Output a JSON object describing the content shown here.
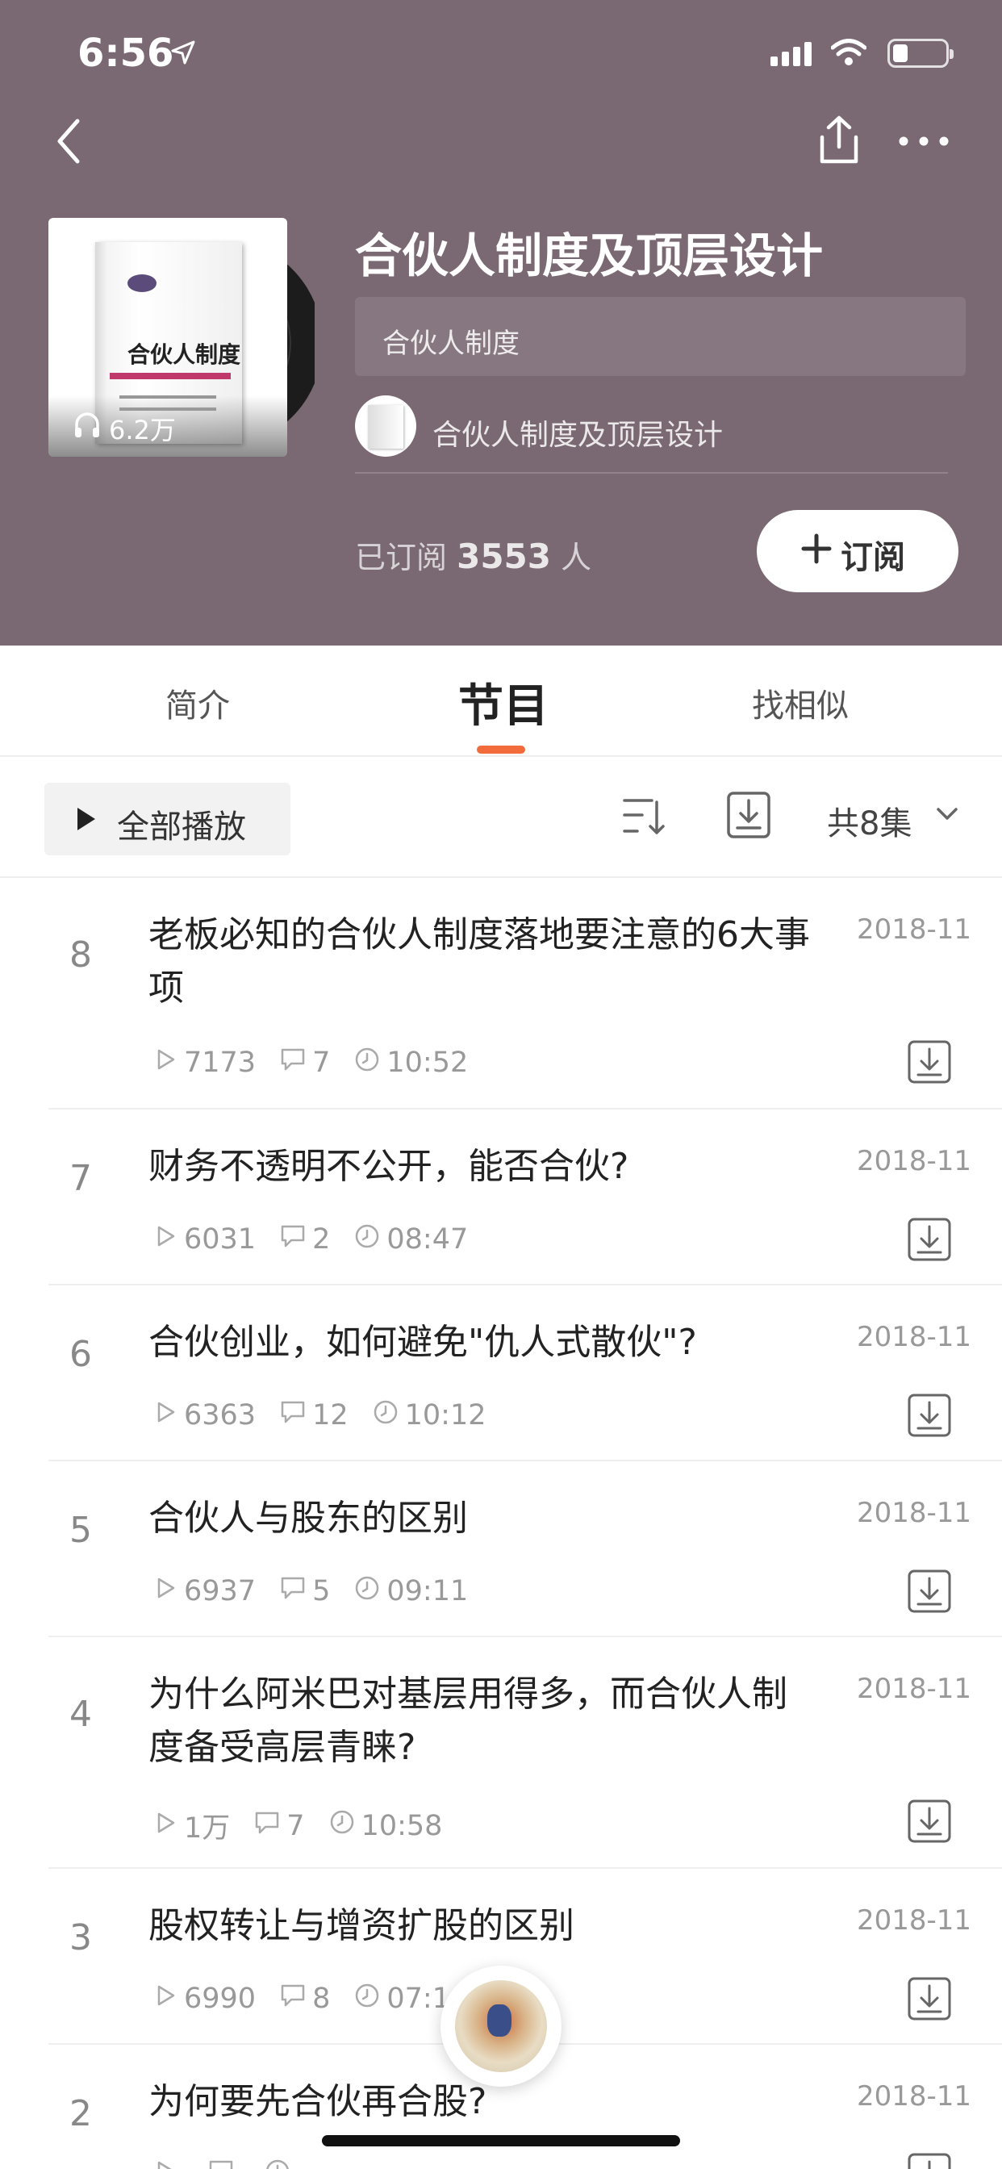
{
  "status_bar": {
    "time": "6:56"
  },
  "album": {
    "title": "合伙人制度及顶层设计",
    "tag": "合伙人制度",
    "author": "合伙人制度及顶层设计",
    "plays": "6.2万",
    "subscribed_prefix": "已订阅",
    "subscribed_count": "3553",
    "subscribed_suffix": "人",
    "subscribe_label": "订阅",
    "cover_title": "合伙人制度"
  },
  "tabs": [
    {
      "label": "简介"
    },
    {
      "label": "节目"
    },
    {
      "label": "找相似"
    }
  ],
  "toolbar": {
    "play_all_label": "全部播放",
    "count_label": "共8集"
  },
  "episodes": [
    {
      "num": "8",
      "title": "老板必知的合伙人制度落地要注意的6大事项",
      "date": "2018-11",
      "plays": "7173",
      "comments": "7",
      "duration": "10:52"
    },
    {
      "num": "7",
      "title": "财务不透明不公开，能否合伙?",
      "date": "2018-11",
      "plays": "6031",
      "comments": "2",
      "duration": "08:47"
    },
    {
      "num": "6",
      "title": "合伙创业，如何避免\"仇人式散伙\"?",
      "date": "2018-11",
      "plays": "6363",
      "comments": "12",
      "duration": "10:12"
    },
    {
      "num": "5",
      "title": "合伙人与股东的区别",
      "date": "2018-11",
      "plays": "6937",
      "comments": "5",
      "duration": "09:11"
    },
    {
      "num": "4",
      "title": "为什么阿米巴对基层用得多，而合伙人制度备受高层青睐?",
      "date": "2018-11",
      "plays": "1万",
      "comments": "7",
      "duration": "10:58"
    },
    {
      "num": "3",
      "title": "股权转让与增资扩股的区别",
      "date": "2018-11",
      "plays": "6990",
      "comments": "8",
      "duration": "07:16"
    },
    {
      "num": "2",
      "title": "为何要先合伙再合股?",
      "date": "2018-11",
      "plays": "",
      "comments": "",
      "duration": ""
    }
  ],
  "colors": {
    "header_bg": "#7a6872",
    "accent": "#f26b3a"
  }
}
